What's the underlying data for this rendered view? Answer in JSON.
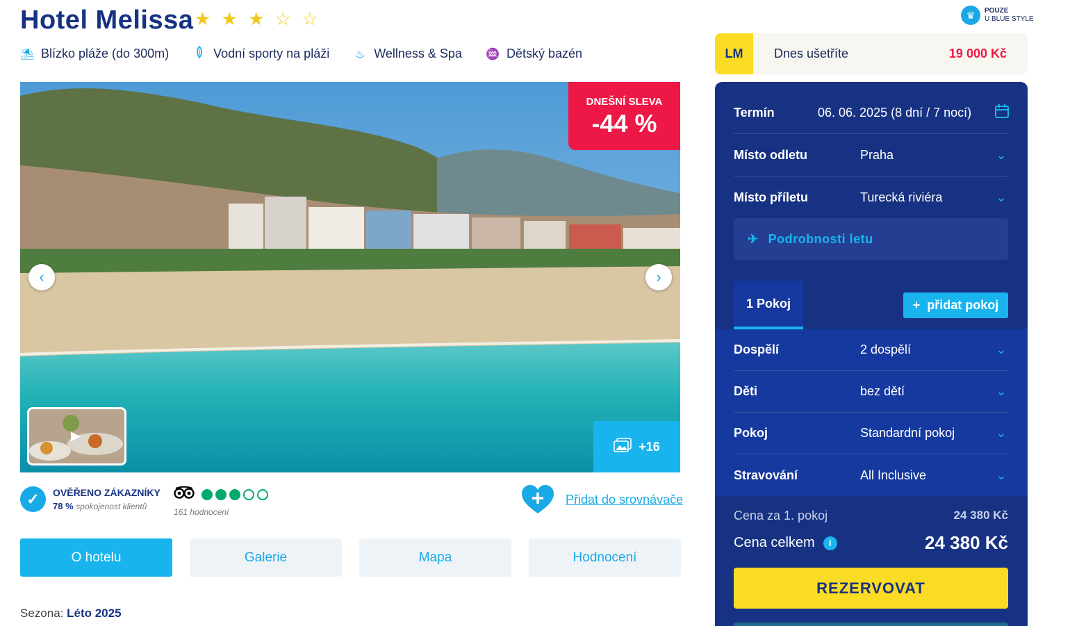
{
  "hotel": {
    "name": "Hotel Melissa",
    "stars_filled": 3,
    "stars_total": 5,
    "stars_full_glyphs": "★ ★ ★",
    "stars_empty_glyphs": "☆ ☆"
  },
  "features": [
    {
      "icon": "umbrella-icon",
      "glyph": "⛱",
      "label": "Blízko pláže (do 300m)"
    },
    {
      "icon": "surfboard-icon",
      "glyph": "🏄",
      "label": "Vodní sporty na pláži"
    },
    {
      "icon": "spa-icon",
      "glyph": "♨",
      "label": "Wellness & Spa"
    },
    {
      "icon": "kids-pool-icon",
      "glyph": "♒",
      "label": "Dětský bazén"
    }
  ],
  "exclusive": {
    "line1": "POUZE",
    "line2": "U BLUE STYLE",
    "icon": "crown-icon"
  },
  "gallery": {
    "discount_label": "DNEŠNÍ SLEVA",
    "discount_value": "-44 %",
    "more_photos": "+16",
    "prev_glyph": "‹",
    "next_glyph": "›"
  },
  "verified": {
    "title": "OVĚŘENO ZÁKAZNÍKY",
    "percent": "78 %",
    "label": "spokojenost klientů"
  },
  "tripadvisor": {
    "bubbles_filled": 3,
    "bubbles_total": 5,
    "count": "161 hodnocení"
  },
  "compare": {
    "label": "Přidat do srovnávače"
  },
  "tabs": [
    {
      "label": "O hotelu",
      "active": true
    },
    {
      "label": "Galerie",
      "active": false
    },
    {
      "label": "Mapa",
      "active": false
    },
    {
      "label": "Hodnocení",
      "active": false
    }
  ],
  "season": {
    "label": "Sezona:",
    "value": "Léto 2025"
  },
  "lastminute": {
    "badge": "LM",
    "text": "Dnes ušetříte",
    "amount": "19 000 Kč"
  },
  "booking": {
    "termin": {
      "label": "Termín",
      "value": "06. 06. 2025 (8 dní / 7 nocí)"
    },
    "departure": {
      "label": "Místo odletu",
      "value": "Praha"
    },
    "arrival": {
      "label": "Místo příletu",
      "value": "Turecká riviéra"
    },
    "flight_details": "Podrobnosti letu",
    "room_tab": "1 Pokoj",
    "add_room": "přidat pokoj",
    "adults": {
      "label": "Dospělí",
      "value": "2 dospělí"
    },
    "children": {
      "label": "Děti",
      "value": "bez dětí"
    },
    "room": {
      "label": "Pokoj",
      "value": "Standardní pokoj"
    },
    "board": {
      "label": "Stravování",
      "value": "All Inclusive"
    },
    "price_room_label": "Cena za 1. pokoj",
    "price_room": "24 380 Kč",
    "price_total_label": "Cena celkem",
    "price_total": "24 380 Kč",
    "reserve": "REZERVOVAT"
  },
  "colors": {
    "brand_navy": "#173282",
    "accent_blue": "#19b4ee",
    "discount_red": "#ee1847",
    "cta_yellow": "#f9dc23",
    "tripadvisor_green": "#00aa6c"
  }
}
